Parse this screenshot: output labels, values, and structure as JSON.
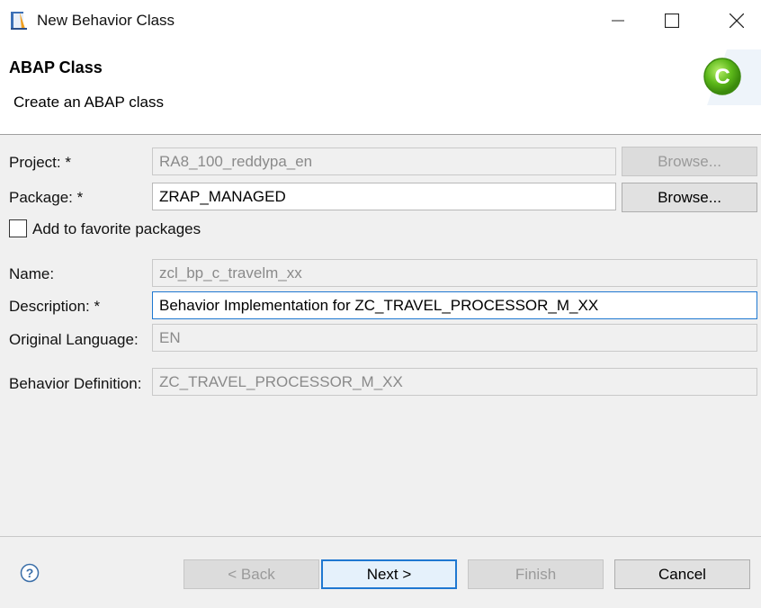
{
  "window": {
    "title": "New Behavior Class"
  },
  "header": {
    "title": "ABAP Class",
    "description": "Create an ABAP class"
  },
  "form": {
    "project": {
      "label": "Project: *",
      "value": "RA8_100_reddypa_en",
      "browse": "Browse..."
    },
    "package": {
      "label": "Package: *",
      "value": "ZRAP_MANAGED",
      "browse": "Browse..."
    },
    "favorite": {
      "label": "Add to favorite packages",
      "checked": false
    },
    "name": {
      "label": "Name:",
      "value": "zcl_bp_c_travelm_xx"
    },
    "description": {
      "label": "Description: *",
      "value": "Behavior Implementation for ZC_TRAVEL_PROCESSOR_M_XX"
    },
    "language": {
      "label": "Original Language:",
      "value": "EN"
    },
    "behavior": {
      "label": "Behavior Definition:",
      "value": "ZC_TRAVEL_PROCESSOR_M_XX"
    }
  },
  "buttons": {
    "back": "< Back",
    "next": "Next >",
    "finish": "Finish",
    "cancel": "Cancel"
  },
  "colors": {
    "accent": "#1f78d1",
    "class_icon_green": "#6cc11c"
  }
}
